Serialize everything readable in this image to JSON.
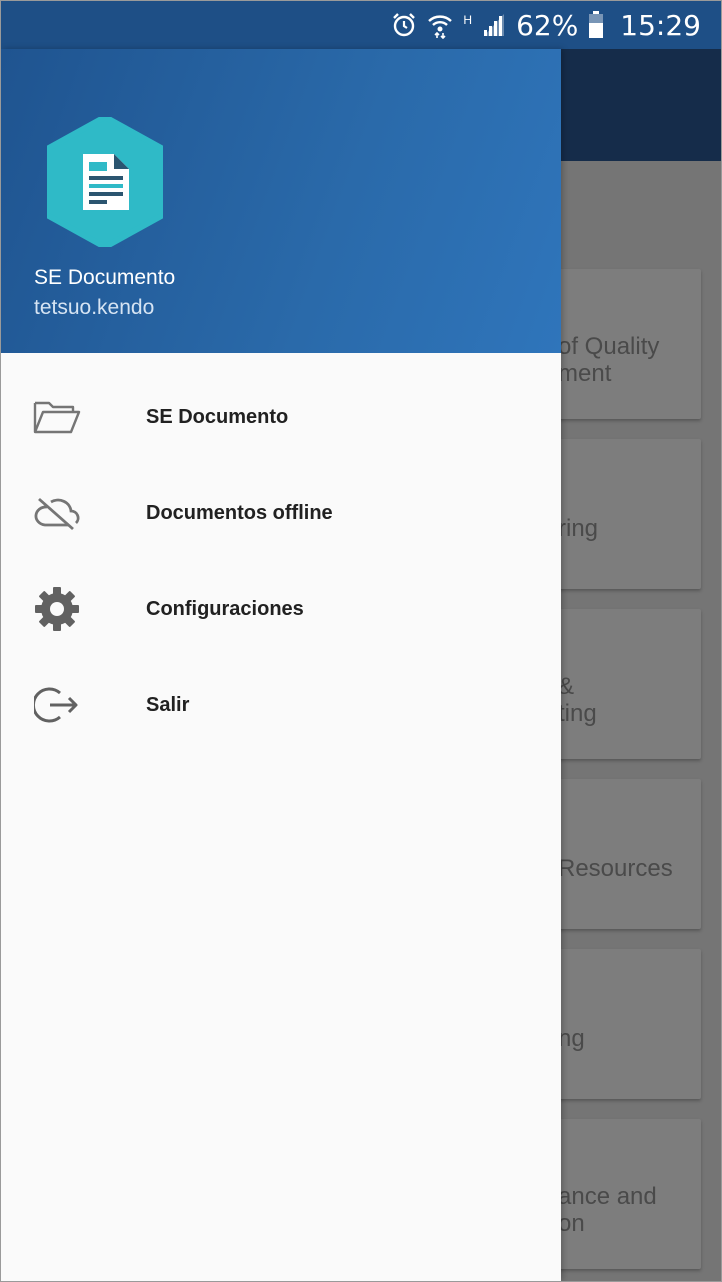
{
  "status_bar": {
    "network_type": "H",
    "battery_percent": "62%",
    "time": "15:29",
    "icons": [
      "alarm-icon",
      "wifi-icon",
      "signal-icon",
      "battery-icon"
    ]
  },
  "drawer": {
    "header": {
      "app_name": "SE Documento",
      "user_name": "tetsuo.kendo",
      "logo_icon": "document-logo-icon"
    },
    "items": [
      {
        "label": "SE Documento",
        "icon": "folder-open-icon"
      },
      {
        "label": "Documentos offline",
        "icon": "cloud-off-icon"
      },
      {
        "label": "Configuraciones",
        "icon": "gear-icon"
      },
      {
        "label": "Salir",
        "icon": "logout-icon"
      }
    ]
  },
  "background_cards": [
    {
      "line1": "of Quality",
      "line2": "ment"
    },
    {
      "line1": "ring",
      "line2": ""
    },
    {
      "line1": "&",
      "line2": "ting"
    },
    {
      "line1": "Resources",
      "line2": ""
    },
    {
      "line1": "ng",
      "line2": ""
    },
    {
      "line1": "ance and",
      "line2": "on"
    }
  ],
  "colors": {
    "header_blue": "#2a6aaa",
    "status_bar": "#1e4f86",
    "logo_teal": "#2fbac7",
    "scrim": "#757575"
  }
}
